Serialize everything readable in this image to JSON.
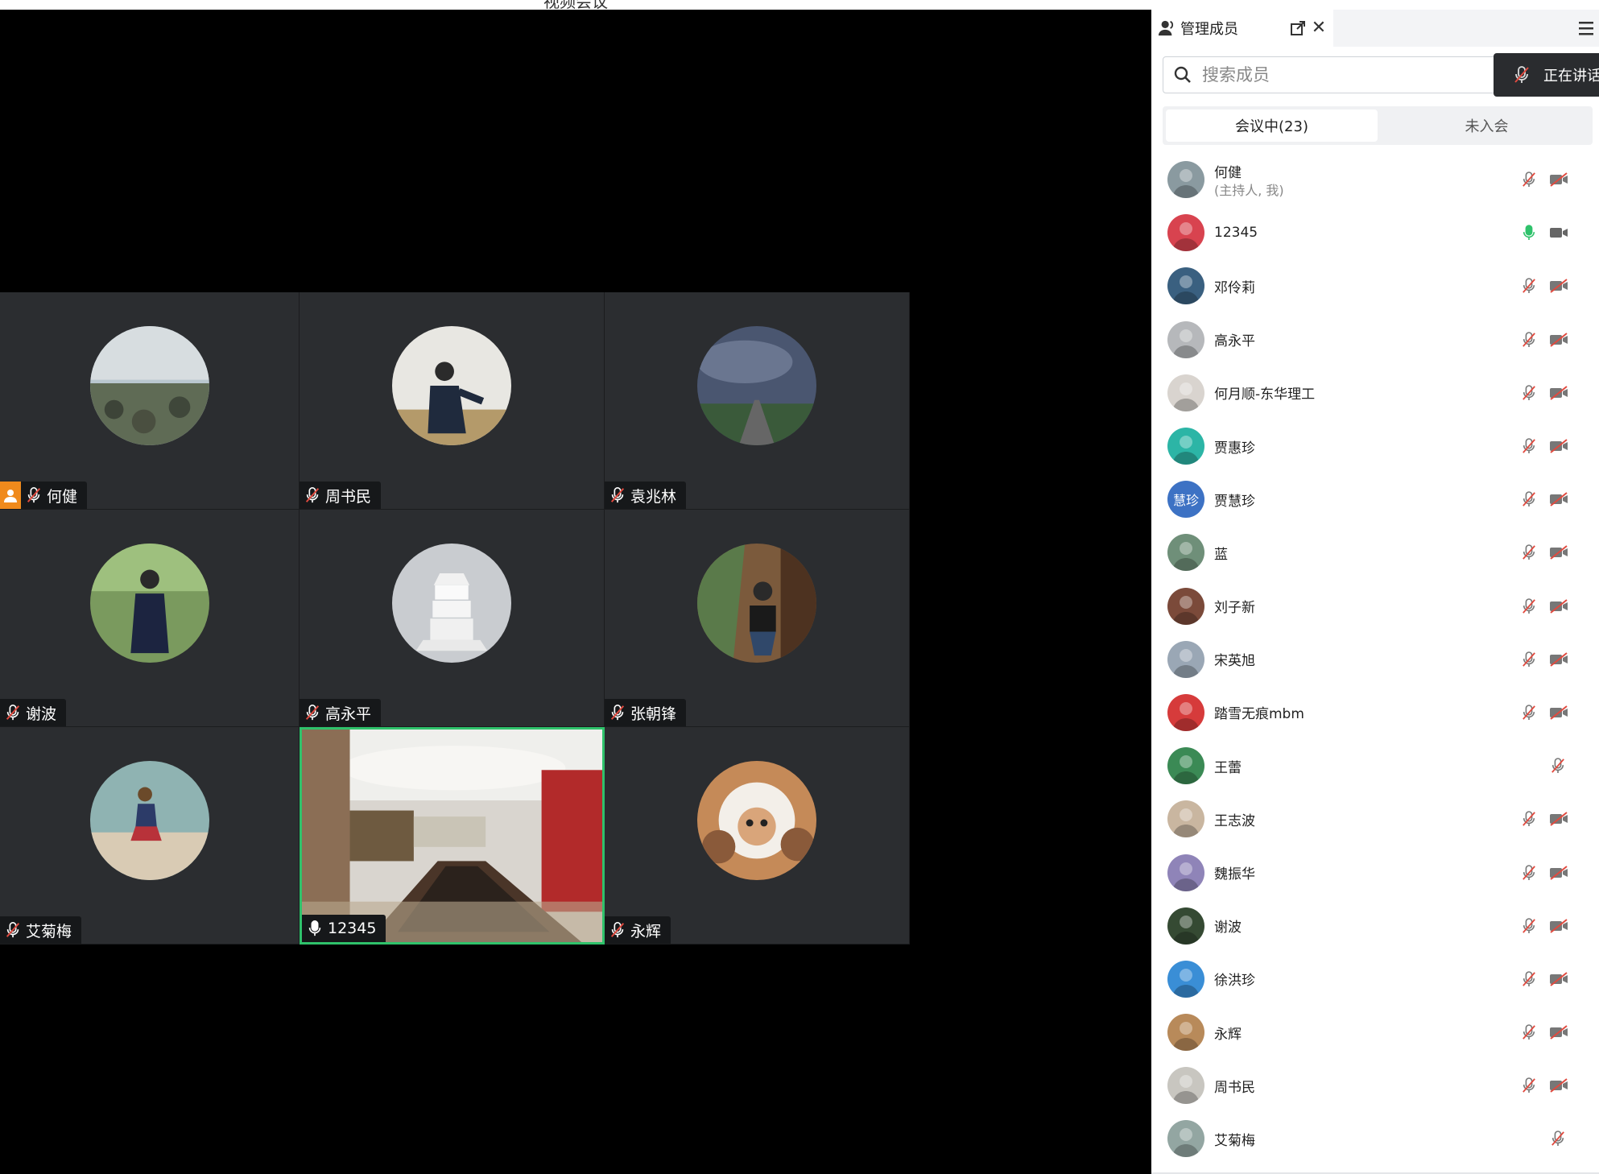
{
  "window": {
    "title": "视频会议"
  },
  "colors": {
    "speaking_border": "#2fc26b",
    "host_badge": "#f08a1c",
    "mic_active": "#2fc26b",
    "mic_muted": "#e04a3f"
  },
  "video_grid": [
    {
      "name": "何健",
      "is_host": true,
      "mic": "muted",
      "avatar": "seaside-rocks"
    },
    {
      "name": "周书民",
      "is_host": false,
      "mic": "muted",
      "avatar": "man-in-field"
    },
    {
      "name": "袁兆林",
      "is_host": false,
      "mic": "muted",
      "avatar": "cloudy-road"
    },
    {
      "name": "谢波",
      "is_host": false,
      "mic": "muted",
      "avatar": "man-under-trees"
    },
    {
      "name": "高永平",
      "is_host": false,
      "mic": "muted",
      "avatar": "white-pagoda"
    },
    {
      "name": "张朝锋",
      "is_host": false,
      "mic": "muted",
      "avatar": "man-on-stairs"
    },
    {
      "name": "艾菊梅",
      "is_host": false,
      "mic": "muted",
      "avatar": "woman-on-beach"
    },
    {
      "name": "12345",
      "is_host": false,
      "mic": "active",
      "video": true,
      "avatar": "conference-room"
    },
    {
      "name": "永辉",
      "is_host": false,
      "mic": "muted",
      "avatar": "plush-toys"
    }
  ],
  "panel": {
    "title": "管理成员",
    "search_placeholder": "搜索成员",
    "speaking_label": "正在讲话",
    "tabs": [
      {
        "label": "会议中(23)",
        "active": true
      },
      {
        "label": "未入会",
        "active": false
      }
    ],
    "participants": [
      {
        "name": "何健",
        "sub": "(主持人, 我)",
        "mic": "muted",
        "cam": "off",
        "avatar": "#8a9aa0"
      },
      {
        "name": "12345",
        "mic": "active",
        "cam": "on",
        "avatar": "#d8434f"
      },
      {
        "name": "邓伶莉",
        "mic": "muted",
        "cam": "off",
        "avatar": "#3a6080"
      },
      {
        "name": "高永平",
        "mic": "muted",
        "cam": "off",
        "avatar": "#b6b8bb"
      },
      {
        "name": "何月顺-东华理工",
        "mic": "muted",
        "cam": "off",
        "avatar": "#d9d4cf"
      },
      {
        "name": "贾惠珍",
        "mic": "muted",
        "cam": "off",
        "avatar": "#2cb5a6"
      },
      {
        "name": "贾慧珍",
        "avatar_text": "慧珍",
        "mic": "muted",
        "cam": "off",
        "avatar": "#3d72c4"
      },
      {
        "name": "蓝",
        "mic": "muted",
        "cam": "off",
        "avatar": "#6f8f79"
      },
      {
        "name": "刘子新",
        "mic": "muted",
        "cam": "off",
        "avatar": "#7b4a3a"
      },
      {
        "name": "宋英旭",
        "mic": "muted",
        "cam": "off",
        "avatar": "#9aa7b5"
      },
      {
        "name": "踏雪无痕mbm",
        "mic": "muted",
        "cam": "off",
        "avatar": "#d63b3b"
      },
      {
        "name": "王蕾",
        "mic": "muted",
        "cam": "none",
        "avatar": "#3b8a55"
      },
      {
        "name": "王志波",
        "mic": "muted",
        "cam": "off",
        "avatar": "#c9b6a0"
      },
      {
        "name": "魏振华",
        "mic": "muted",
        "cam": "off",
        "avatar": "#8f84b8"
      },
      {
        "name": "谢波",
        "mic": "muted",
        "cam": "off",
        "avatar": "#354a33"
      },
      {
        "name": "徐洪珍",
        "mic": "muted",
        "cam": "off",
        "avatar": "#3a8ed6"
      },
      {
        "name": "永辉",
        "mic": "muted",
        "cam": "off",
        "avatar": "#b88a5a"
      },
      {
        "name": "周书民",
        "mic": "muted",
        "cam": "off",
        "avatar": "#c8c6c0"
      },
      {
        "name": "艾菊梅",
        "mic": "muted",
        "cam": "none",
        "avatar": "#93a6a2"
      }
    ]
  }
}
